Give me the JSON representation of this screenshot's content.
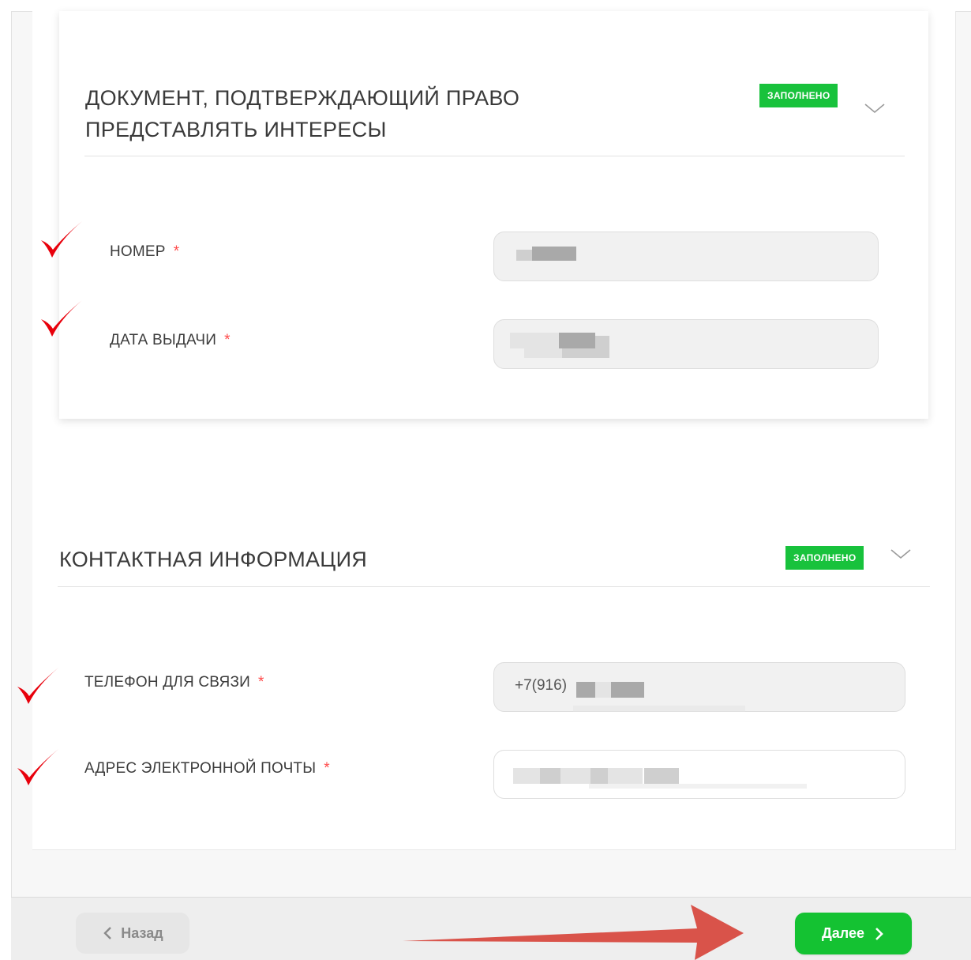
{
  "document_section": {
    "title_line1": "ДОКУМЕНТ, ПОДТВЕРЖДАЮЩИЙ ПРАВО",
    "title_line2": "ПРЕДСТАВЛЯТЬ ИНТЕРЕСЫ",
    "badge": "ЗАПОЛНЕНО",
    "fields": [
      {
        "label": "НОМЕР",
        "required_mark": "*"
      },
      {
        "label": "ДАТА ВЫДАЧИ",
        "required_mark": "*"
      }
    ]
  },
  "contact_section": {
    "title": "КОНТАКТНАЯ ИНФОРМАЦИЯ",
    "badge": "ЗАПОЛНЕНО",
    "fields": [
      {
        "label": "ТЕЛЕФОН ДЛЯ СВЯЗИ",
        "required_mark": "*",
        "value_prefix": "+7(916)"
      },
      {
        "label": "АДРЕС ЭЛЕКТРОННОЙ ПОЧТЫ",
        "required_mark": "*"
      }
    ]
  },
  "footer": {
    "back_label": "Назад",
    "next_label": "Далее"
  },
  "colors": {
    "accent_green": "#14c232",
    "badge_green": "#18c23c",
    "required_red": "#ff4a4a",
    "checkmark_red": "#e8000b",
    "annotation_arrow": "#d9534a"
  },
  "icons": {
    "chevron": "chevron-down-icon",
    "check": "checkmark-icon",
    "back": "chevron-left-icon",
    "next": "chevron-right-icon"
  }
}
